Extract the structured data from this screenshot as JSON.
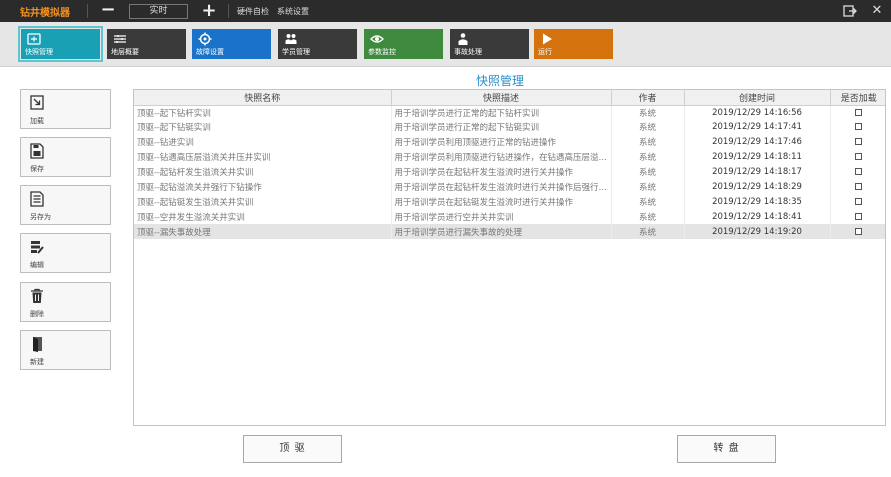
{
  "app": {
    "title": "钻井模拟器"
  },
  "titlebar": {
    "speed_value": "实时",
    "zoom_minus": "−",
    "zoom_plus": "+",
    "menu_items": [
      "硬件自检",
      "系统设置"
    ],
    "close_glyph": "✕"
  },
  "toolbar": {
    "items": [
      {
        "label": "快照管理",
        "color": "#1aa0b4",
        "icon": "snapshot-icon"
      },
      {
        "label": "地层概要",
        "color": "#3a3a3a",
        "icon": "layers-icon"
      },
      {
        "label": "故障设置",
        "color": "#1a73c8",
        "icon": "fault-icon"
      },
      {
        "label": "学员管理",
        "color": "#3a3a3a",
        "icon": "students-icon"
      },
      {
        "label": "参数监控",
        "color": "#3e8a3e",
        "icon": "eye-icon"
      },
      {
        "label": "事故处理",
        "color": "#3a3a3a",
        "icon": "accident-icon"
      },
      {
        "label": "运行",
        "color": "#d4730e",
        "icon": "play-icon"
      }
    ]
  },
  "section_title": "快照管理",
  "side_buttons": [
    {
      "label": "加载",
      "icon": "load-icon"
    },
    {
      "label": "保存",
      "icon": "save-icon"
    },
    {
      "label": "另存为",
      "icon": "save-as-icon"
    },
    {
      "label": "编辑",
      "icon": "edit-icon"
    },
    {
      "label": "删除",
      "icon": "trash-icon"
    },
    {
      "label": "新建",
      "icon": "new-icon"
    }
  ],
  "table": {
    "columns": [
      "快照名称",
      "快照描述",
      "作者",
      "创建时间",
      "是否加载"
    ],
    "rows": [
      {
        "name": "顶驱--起下钻杆实训",
        "desc": "用于培训学员进行正常的起下钻杆实训",
        "author": "系统",
        "time": "2019/12/29 14:16:56"
      },
      {
        "name": "顶驱--起下钻铤实训",
        "desc": "用于培训学员进行正常的起下钻铤实训",
        "author": "系统",
        "time": "2019/12/29 14:17:41"
      },
      {
        "name": "顶驱--钻进实训",
        "desc": "用于培训学员利用顶驱进行正常的钻进操作",
        "author": "系统",
        "time": "2019/12/29 14:17:46"
      },
      {
        "name": "顶驱--钻遇高压层溢流关井压井实训",
        "desc": "用于培训学员利用顶驱进行钻进操作，在钻遇高压层溢流后关井压井",
        "author": "系统",
        "time": "2019/12/29 14:18:11"
      },
      {
        "name": "顶驱--起钻杆发生溢流关井实训",
        "desc": "用于培训学员在起钻杆发生溢流时进行关井操作",
        "author": "系统",
        "time": "2019/12/29 14:18:17"
      },
      {
        "name": "顶驱--起钻溢流关井强行下钻操作",
        "desc": "用于培训学员在起钻杆发生溢流时进行关井操作后强行下钻",
        "author": "系统",
        "time": "2019/12/29 14:18:29"
      },
      {
        "name": "顶驱--起钻铤发生溢流关井实训",
        "desc": "用于培训学员在起钻铤发生溢流时进行关井操作",
        "author": "系统",
        "time": "2019/12/29 14:18:35"
      },
      {
        "name": "顶驱--空井发生溢流关井实训",
        "desc": "用于培训学员进行空井关井实训",
        "author": "系统",
        "time": "2019/12/29 14:18:41"
      },
      {
        "name": "顶驱--漏失事故处理",
        "desc": "用于培训学员进行漏失事故的处理",
        "author": "系统",
        "time": "2019/12/29 14:19:20"
      }
    ]
  },
  "bottom_buttons": {
    "left": "顶 驱",
    "right": "转 盘"
  }
}
